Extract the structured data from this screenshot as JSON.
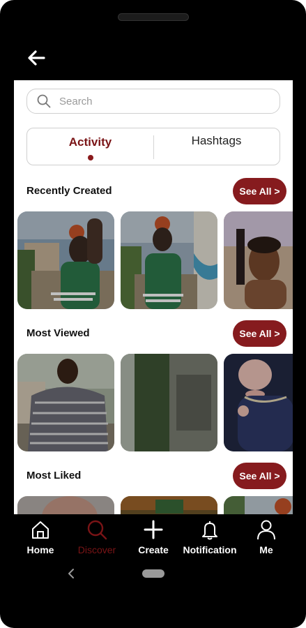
{
  "search": {
    "placeholder": "Search"
  },
  "tabs": [
    {
      "label": "Activity",
      "active": true
    },
    {
      "label": "Hashtags",
      "active": false
    }
  ],
  "sections": [
    {
      "title": "Recently Created",
      "see_all": "See All >"
    },
    {
      "title": "Most Viewed",
      "see_all": "See All >"
    },
    {
      "title": "Most Liked",
      "see_all": "See All >"
    }
  ],
  "nav": [
    {
      "label": "Home",
      "icon": "home-icon"
    },
    {
      "label": "Discover",
      "icon": "search-icon",
      "active": true
    },
    {
      "label": "Create",
      "icon": "plus-icon"
    },
    {
      "label": "Notification",
      "icon": "bell-icon"
    },
    {
      "label": "Me",
      "icon": "person-icon"
    }
  ],
  "colors": {
    "accent": "#861b1e",
    "active_tab_text": "#7a1416",
    "frame": "#000000"
  }
}
